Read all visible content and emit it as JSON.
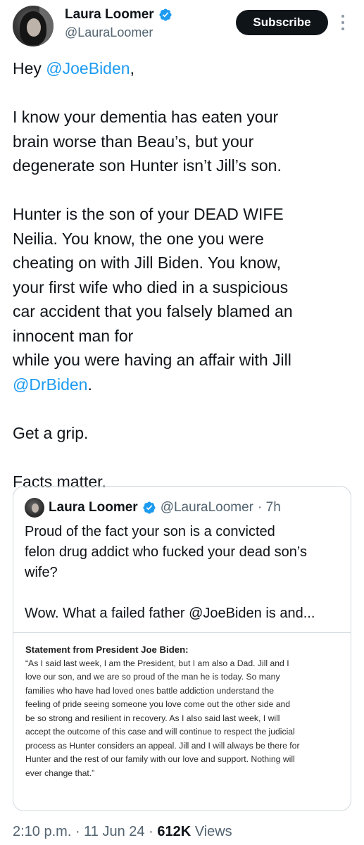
{
  "author": {
    "display_name": "Laura Loomer",
    "handle": "@LauraLoomer",
    "verified": true,
    "avatar_icon": "profile-photo"
  },
  "actions": {
    "subscribe_label": "Subscribe",
    "more_icon": "vertical-ellipsis-icon"
  },
  "tweet": {
    "greeting_prefix": "Hey ",
    "greeting_mention": "@JoeBiden",
    "greeting_suffix": ",",
    "para1_lines": [
      "I know your dementia has eaten your",
      "brain worse than Beau’s, but your",
      "degenerate son Hunter isn’t Jill’s son."
    ],
    "para2_lines": [
      "Hunter is the son of your DEAD WIFE",
      "Neilia. You know, the one you were",
      "cheating on with Jill Biden. You know,",
      "your first wife who died in a suspicious",
      "car accident that you falsely blamed an",
      "innocent man for",
      "while you were having an affair with Jill"
    ],
    "para2_mention": "@DrBiden",
    "para2_mention_suffix": ".",
    "line_grip": "Get a grip.",
    "line_facts": "Facts matter."
  },
  "quote": {
    "display_name": "Laura Loomer",
    "handle": "@LauraLoomer",
    "time": "· 7h",
    "text_lines": [
      "Proud of the fact your son is a convicted",
      "felon drug addict who fucked your dead son’s",
      "wife?"
    ],
    "text_line2": "Wow. What a failed father @JoeBiden is and...",
    "statement_title": "Statement from President Joe Biden:",
    "statement_lines": [
      "“As I said last week, I am the President, but I am also a Dad. Jill and I",
      "love our son, and we are so proud of the man he is today. So many",
      "families who have had loved ones battle addiction understand the",
      "feeling of pride seeing someone you love come out the other side and",
      "be so strong and resilient in recovery. As I also said last week, I will",
      "accept the outcome of this case and will continue to respect the judicial",
      "process as Hunter considers an appeal. Jill and I will always be there for",
      "Hunter and the rest of our family with our love and support. Nothing will",
      "ever change that.”"
    ]
  },
  "meta": {
    "time": "2:10 p.m.",
    "sep1": " · ",
    "date": "11 Jun 24",
    "sep2": " · ",
    "views_count": "612K",
    "views_label": " Views"
  },
  "colors": {
    "link": "#1d9bf0",
    "verified": "#1d9bf0",
    "secondary_text": "#536471",
    "primary_text": "#0f1419"
  }
}
